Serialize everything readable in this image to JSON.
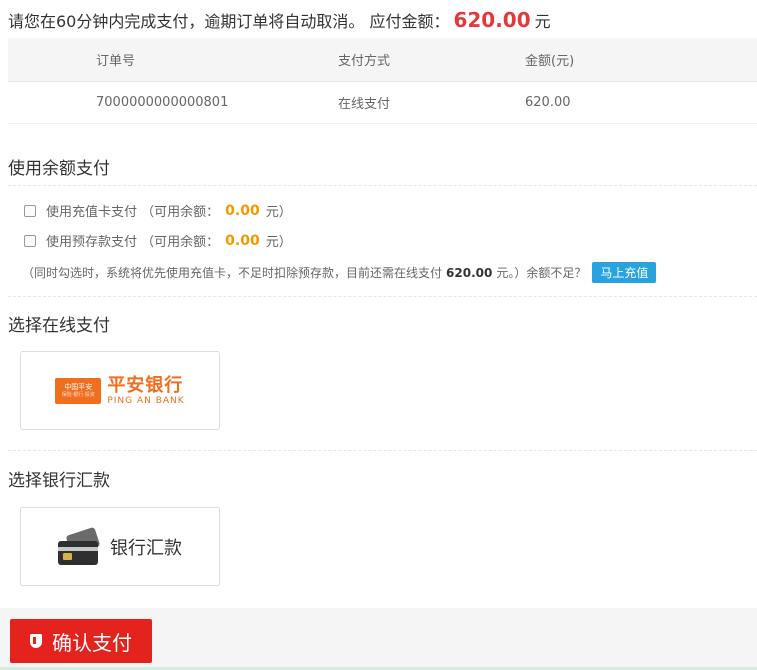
{
  "notice": {
    "prefix": "请您在60分钟内完成支付，逾期订单将自动取消。 应付金额：",
    "amount": "620.00",
    "unit": "元"
  },
  "order_table": {
    "headers": [
      "订单号",
      "支付方式",
      "金额(元)"
    ],
    "rows": [
      [
        "7000000000000801",
        "在线支付",
        "620.00"
      ]
    ]
  },
  "balance": {
    "title": "使用余额支付",
    "card": {
      "label": "使用充值卡支付 （可用余额：",
      "amount": "0.00",
      "suffix": "元）"
    },
    "deposit": {
      "label": "使用预存款支付 （可用余额：",
      "amount": "0.00",
      "suffix": "元）"
    },
    "note_prefix": "（同时勾选时，系统将优先使用充值卡，不足时扣除预存款，目前还需在线支付",
    "note_amount": "620.00",
    "note_suffix": "元。）余额不足？",
    "recharge_label": "马上充值"
  },
  "online": {
    "title": "选择在线支付",
    "bank_logo_text": "平安银行",
    "bank_logo_en": "PING AN BANK",
    "bank_badge_text": "中国平安",
    "bank_badge_sub": "保险·银行·投资"
  },
  "remittance": {
    "title": "选择银行汇款",
    "label": "银行汇款"
  },
  "confirm": {
    "label": "确认支付"
  }
}
